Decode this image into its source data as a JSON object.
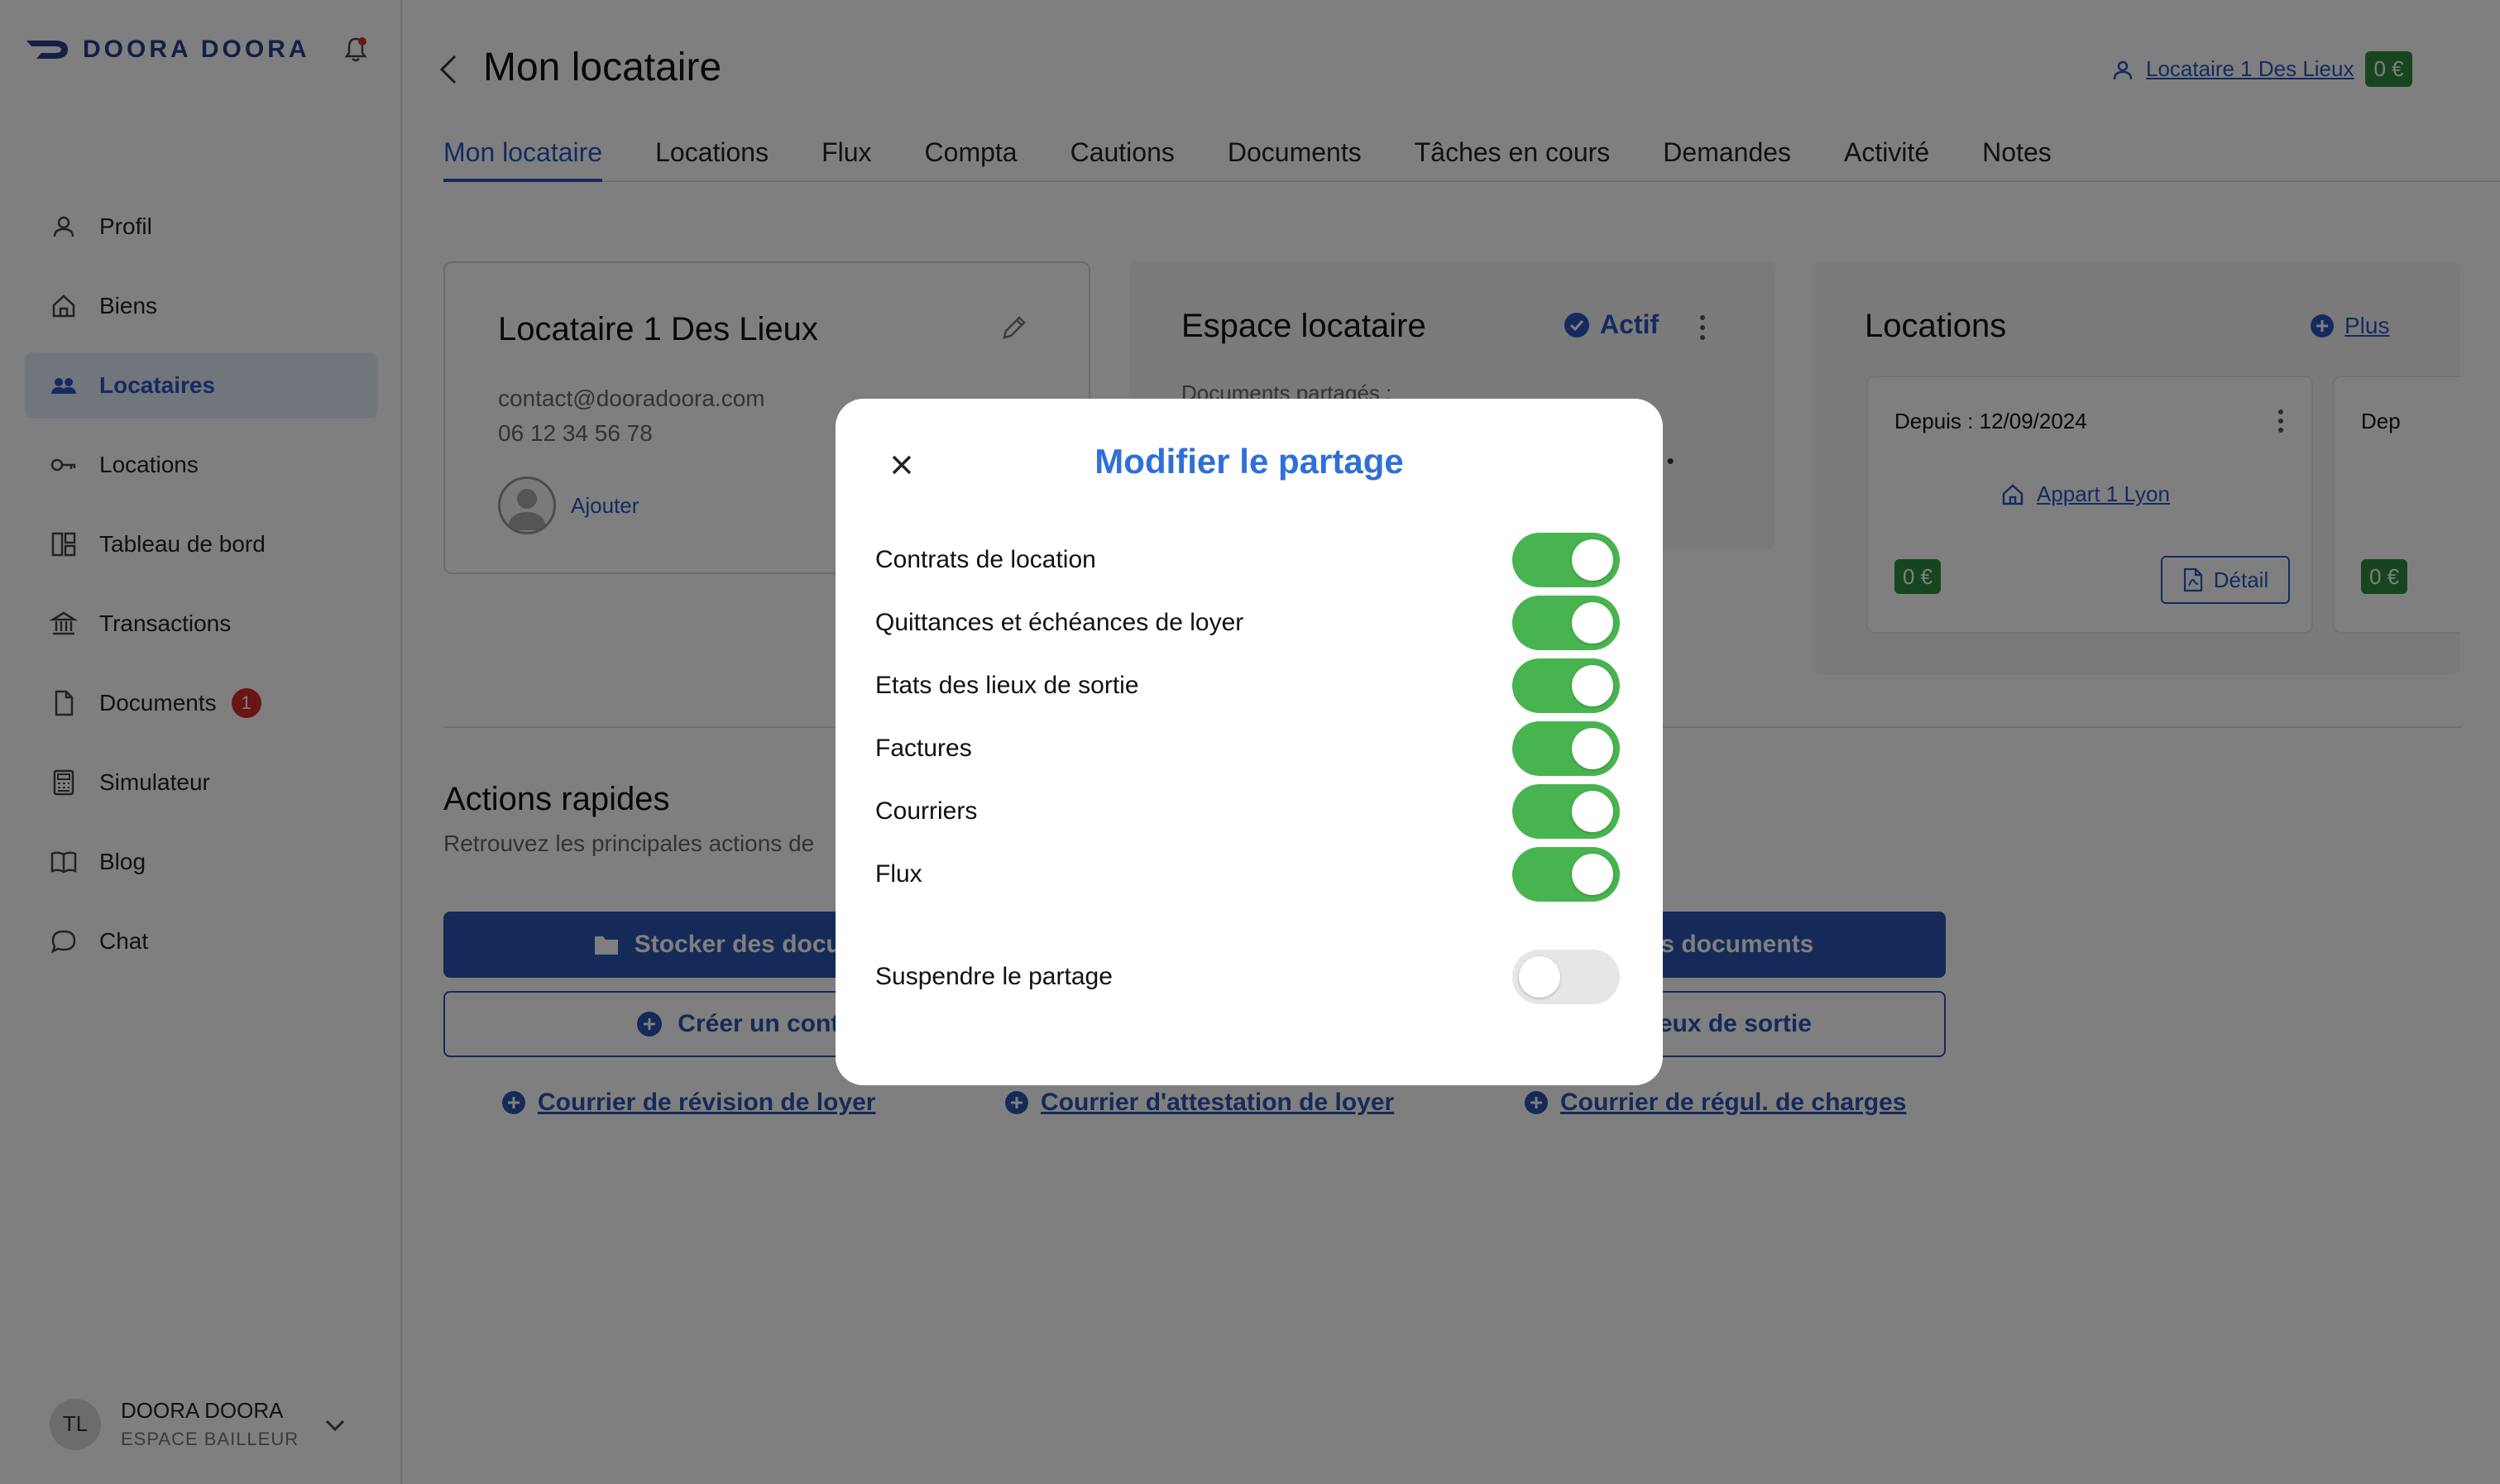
{
  "brand": {
    "name": "DOORA DOORA",
    "color": "#2a3f8f"
  },
  "sidebar": {
    "items": [
      {
        "label": "Profil",
        "icon": "user-icon"
      },
      {
        "label": "Biens",
        "icon": "home-icon"
      },
      {
        "label": "Locataires",
        "icon": "users-icon",
        "active": true
      },
      {
        "label": "Locations",
        "icon": "key-icon"
      },
      {
        "label": "Tableau de bord",
        "icon": "dashboard-icon"
      },
      {
        "label": "Transactions",
        "icon": "bank-icon"
      },
      {
        "label": "Documents",
        "icon": "document-icon",
        "badge": "1"
      },
      {
        "label": "Simulateur",
        "icon": "calculator-icon"
      },
      {
        "label": "Blog",
        "icon": "book-icon"
      },
      {
        "label": "Chat",
        "icon": "chat-icon"
      }
    ],
    "user": {
      "initials": "TL",
      "name": "DOORA DOORA",
      "role": "ESPACE BAILLEUR"
    }
  },
  "header": {
    "title": "Mon locataire",
    "tenant_link": "Locataire 1 Des Lieux",
    "balance": "0 €"
  },
  "tabs": [
    "Mon locataire",
    "Locations",
    "Flux",
    "Compta",
    "Cautions",
    "Documents",
    "Tâches en cours",
    "Demandes",
    "Activité",
    "Notes"
  ],
  "tenant_card": {
    "name": "Locataire 1 Des Lieux",
    "email": "contact@dooradoora.com",
    "phone": "06 12 34 56 78",
    "add_label": "Ajouter"
  },
  "space_card": {
    "title": "Espace locataire",
    "status": "Actif",
    "shared_label": "Documents partagés :",
    "fragment": "es •"
  },
  "locations_card": {
    "title": "Locations",
    "plus_label": "Plus",
    "rentals": [
      {
        "since": "Depuis : 12/09/2024",
        "property": "Appart 1 Lyon",
        "balance": "0 €",
        "detail_label": "Détail"
      },
      {
        "since": "Dep",
        "balance": "0 €"
      }
    ]
  },
  "quick_actions": {
    "title": "Actions rapides",
    "subtitle": "Retrouvez les principales actions de",
    "primary_left": "Stocker des documents",
    "primary_right": "er des documents",
    "outline_left": "Créer un contrat",
    "outline_right": "les lieux de sortie",
    "links": [
      "Courrier de révision de loyer",
      "Courrier d'attestation de loyer",
      "Courrier de régul. de charges"
    ]
  },
  "modal": {
    "title": "Modifier le partage",
    "toggles": [
      {
        "label": "Contrats de location",
        "on": true
      },
      {
        "label": "Quittances et échéances de loyer",
        "on": true
      },
      {
        "label": "Etats des lieux de sortie",
        "on": true
      },
      {
        "label": "Factures",
        "on": true
      },
      {
        "label": "Courriers",
        "on": true
      },
      {
        "label": "Flux",
        "on": true
      }
    ],
    "suspend": {
      "label": "Suspendre le partage",
      "on": false
    }
  },
  "colors": {
    "accent": "#2b55c2",
    "success": "#48b44f",
    "badge_green": "#2e8c3c",
    "alert": "#d42a2a"
  }
}
